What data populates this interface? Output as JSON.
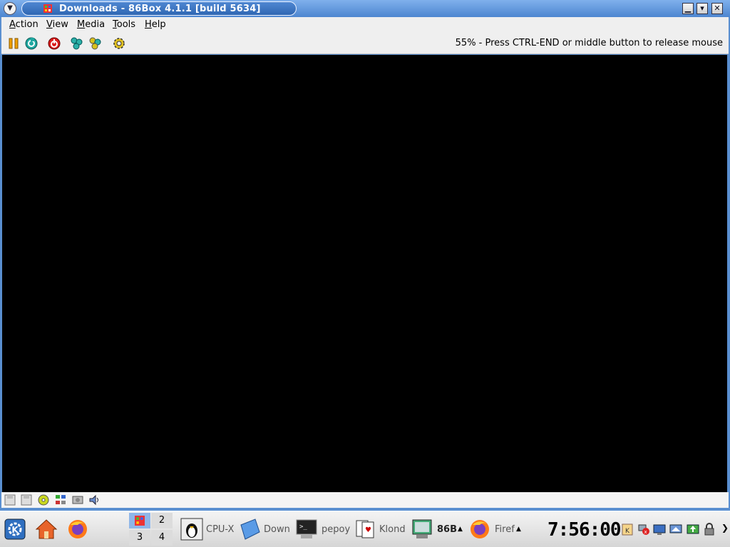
{
  "window": {
    "title": "Downloads - 86Box 4.1.1 [build 5634]",
    "menu_button_icon": "chevron-down-icon",
    "minimize_glyph": "▁",
    "maximize_glyph": "▾",
    "close_glyph": "✕"
  },
  "menubar": {
    "items": [
      {
        "first": "A",
        "rest": "ction"
      },
      {
        "first": "V",
        "rest": "iew"
      },
      {
        "first": "M",
        "rest": "edia"
      },
      {
        "first": "T",
        "rest": "ools"
      },
      {
        "first": "H",
        "rest": "elp"
      }
    ]
  },
  "toolbar": {
    "icons": [
      "pause-icon",
      "reset-icon",
      "power-icon",
      "ctrl-alt-del-icon",
      "ctrl-alt-esc-icon",
      "settings-icon"
    ],
    "status_message": "55% - Press CTRL-END or middle button to release mouse"
  },
  "statusbar": {
    "icons": [
      "floppy-a-icon",
      "floppy-b-icon",
      "cdrom-icon",
      "network-icon",
      "hard-disk-icon",
      "sound-icon"
    ]
  },
  "taskbar": {
    "desktops": [
      "2",
      "3",
      "4"
    ],
    "tasks": [
      {
        "label": "CPU-X",
        "icon": "tux-icon"
      },
      {
        "label": "Down",
        "icon": "folder-icon"
      },
      {
        "label": "pepoy",
        "icon": "terminal-icon"
      },
      {
        "label": "Klond",
        "icon": "cards-icon"
      },
      {
        "label": "86B",
        "icon": "86box-icon"
      },
      {
        "label": "Firef",
        "icon": "firefox-icon"
      }
    ],
    "clock": "7:56:00",
    "colors": {
      "accent": "#4d86d0",
      "screen": "#000000"
    }
  }
}
